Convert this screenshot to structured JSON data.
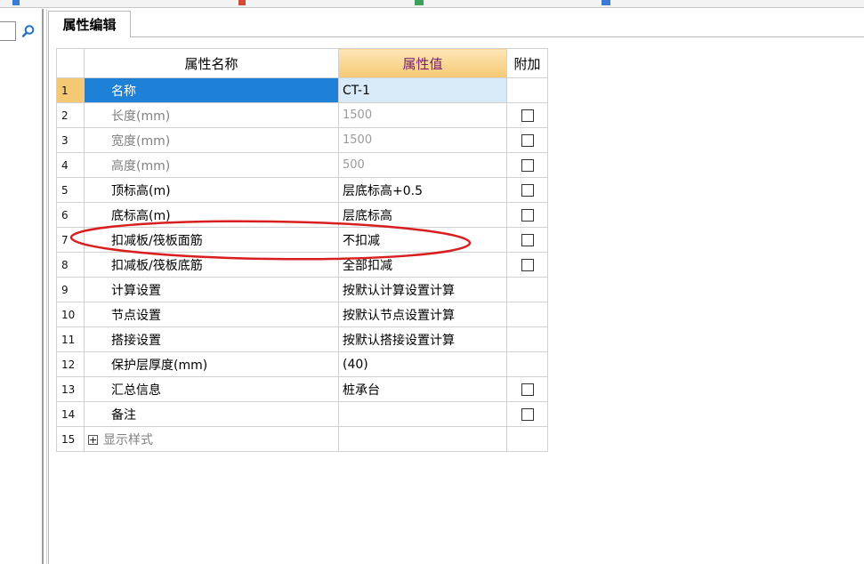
{
  "panel": {
    "tab_label": "属性编辑"
  },
  "table": {
    "headers": {
      "name": "属性名称",
      "value": "属性值",
      "extra": "附加"
    },
    "rows": [
      {
        "num": "1",
        "name": "名称",
        "value": "CT-1",
        "checkbox": false
      },
      {
        "num": "2",
        "name": "长度(mm)",
        "value": "1500",
        "checkbox": true
      },
      {
        "num": "3",
        "name": "宽度(mm)",
        "value": "1500",
        "checkbox": true
      },
      {
        "num": "4",
        "name": "高度(mm)",
        "value": "500",
        "checkbox": true
      },
      {
        "num": "5",
        "name": "顶标高(m)",
        "value": "层底标高+0.5",
        "checkbox": true
      },
      {
        "num": "6",
        "name": "底标高(m)",
        "value": "层底标高",
        "checkbox": true
      },
      {
        "num": "7",
        "name": "扣减板/筏板面筋",
        "value": "不扣减",
        "checkbox": true
      },
      {
        "num": "8",
        "name": "扣减板/筏板底筋",
        "value": "全部扣减",
        "checkbox": true
      },
      {
        "num": "9",
        "name": "计算设置",
        "value": "按默认计算设置计算",
        "checkbox": false
      },
      {
        "num": "10",
        "name": "节点设置",
        "value": "按默认节点设置计算",
        "checkbox": false
      },
      {
        "num": "11",
        "name": "搭接设置",
        "value": "按默认搭接设置计算",
        "checkbox": false
      },
      {
        "num": "12",
        "name": "保护层厚度(mm)",
        "value": "(40)",
        "checkbox": false
      },
      {
        "num": "13",
        "name": "汇总信息",
        "value": "桩承台",
        "checkbox": true
      },
      {
        "num": "14",
        "name": "备注",
        "value": "",
        "checkbox": true
      },
      {
        "num": "15",
        "name": "显示样式",
        "value": "",
        "checkbox": false
      }
    ]
  },
  "annotation": {
    "color": "#d81e1e"
  }
}
